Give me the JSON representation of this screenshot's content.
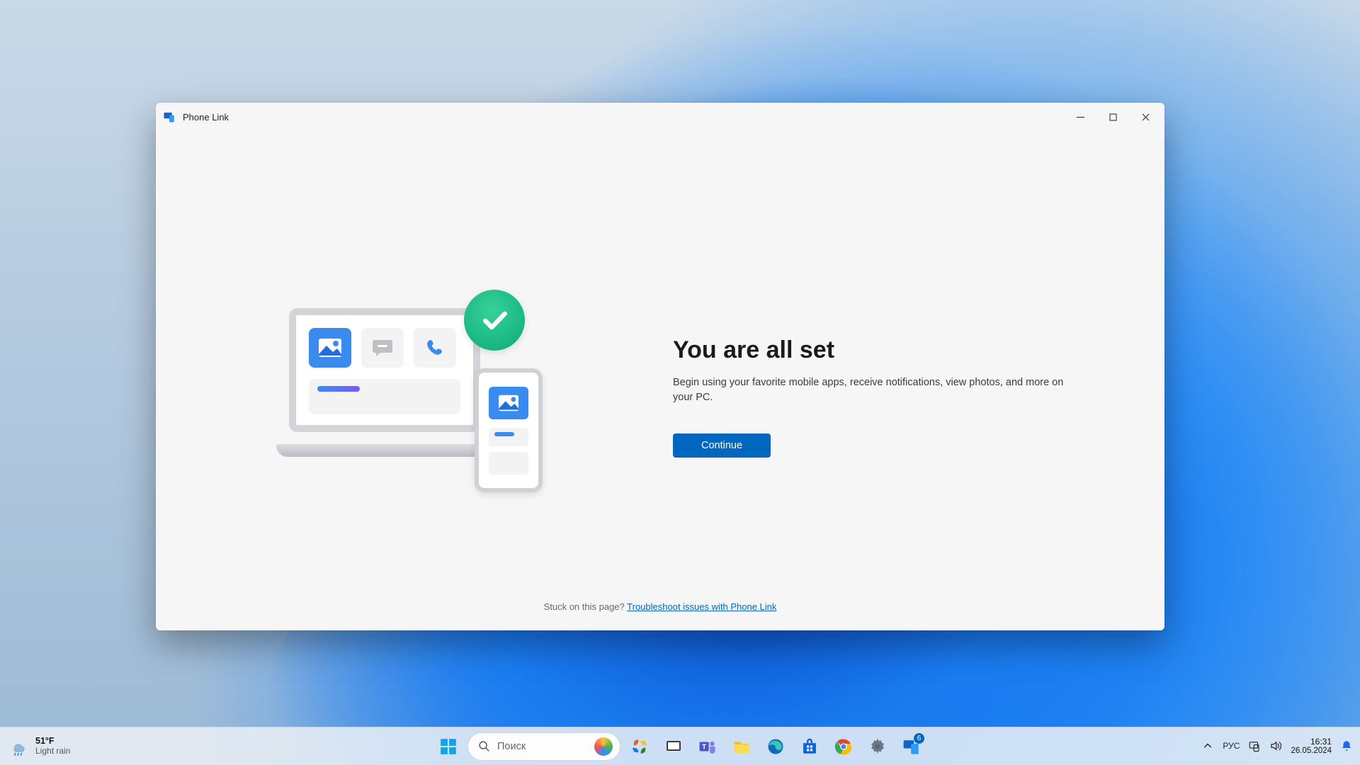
{
  "window": {
    "title": "Phone Link",
    "heading": "You are all set",
    "body": "Begin using your favorite mobile apps, receive notifications, view photos, and more on your PC.",
    "continue_label": "Continue",
    "footer_prompt": "Stuck on this page? ",
    "footer_link": "Troubleshoot issues with Phone Link"
  },
  "taskbar": {
    "weather_temp": "51°F",
    "weather_desc": "Light rain",
    "search_placeholder": "Поиск",
    "phone_link_badge": "6",
    "language": "РУС",
    "time": "16:31",
    "date": "26.05.2024"
  },
  "colors": {
    "accent": "#0067c0"
  }
}
